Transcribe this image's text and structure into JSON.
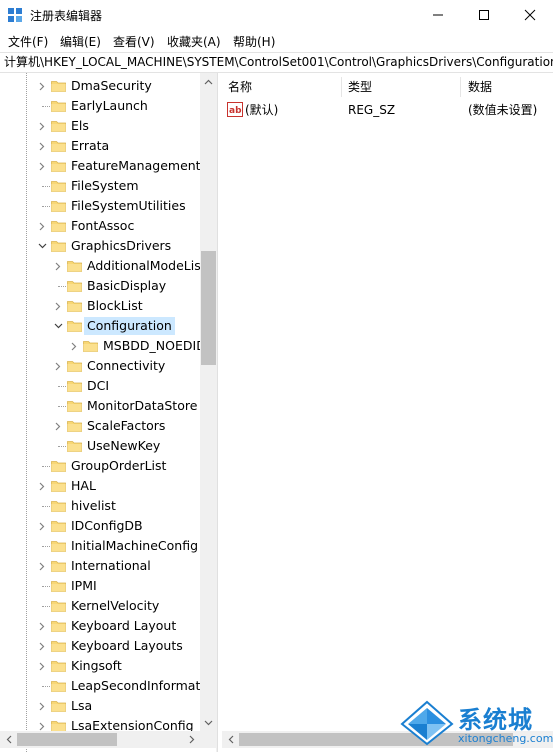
{
  "window": {
    "title": "注册表编辑器",
    "icon": "registry-editor-icon",
    "buttons": [
      "minimize-icon",
      "maximize-icon",
      "close-icon"
    ]
  },
  "menu": [
    "文件(F)",
    "编辑(E)",
    "查看(V)",
    "收藏夹(A)",
    "帮助(H)"
  ],
  "address": "计算机\\HKEY_LOCAL_MACHINE\\SYSTEM\\ControlSet001\\Control\\GraphicsDrivers\\Configuration",
  "tree": {
    "items": [
      {
        "label": "DmaSecurity",
        "level": 0,
        "expander": "collapsed"
      },
      {
        "label": "EarlyLaunch",
        "level": 0,
        "expander": "none"
      },
      {
        "label": "Els",
        "level": 0,
        "expander": "collapsed"
      },
      {
        "label": "Errata",
        "level": 0,
        "expander": "collapsed"
      },
      {
        "label": "FeatureManagement",
        "level": 0,
        "expander": "collapsed"
      },
      {
        "label": "FileSystem",
        "level": 0,
        "expander": "none"
      },
      {
        "label": "FileSystemUtilities",
        "level": 0,
        "expander": "none"
      },
      {
        "label": "FontAssoc",
        "level": 0,
        "expander": "collapsed"
      },
      {
        "label": "GraphicsDrivers",
        "level": 0,
        "expander": "expanded"
      },
      {
        "label": "AdditionalModeList",
        "level": 1,
        "expander": "collapsed"
      },
      {
        "label": "BasicDisplay",
        "level": 1,
        "expander": "none"
      },
      {
        "label": "BlockList",
        "level": 1,
        "expander": "collapsed"
      },
      {
        "label": "Configuration",
        "level": 1,
        "expander": "expanded",
        "selected": true
      },
      {
        "label": "MSBDD_NOEDID",
        "level": 2,
        "expander": "collapsed"
      },
      {
        "label": "Connectivity",
        "level": 1,
        "expander": "collapsed"
      },
      {
        "label": "DCI",
        "level": 1,
        "expander": "none"
      },
      {
        "label": "MonitorDataStore",
        "level": 1,
        "expander": "none"
      },
      {
        "label": "ScaleFactors",
        "level": 1,
        "expander": "collapsed"
      },
      {
        "label": "UseNewKey",
        "level": 1,
        "expander": "none"
      },
      {
        "label": "GroupOrderList",
        "level": 0,
        "expander": "none"
      },
      {
        "label": "HAL",
        "level": 0,
        "expander": "collapsed"
      },
      {
        "label": "hivelist",
        "level": 0,
        "expander": "none"
      },
      {
        "label": "IDConfigDB",
        "level": 0,
        "expander": "collapsed"
      },
      {
        "label": "InitialMachineConfig",
        "level": 0,
        "expander": "none"
      },
      {
        "label": "International",
        "level": 0,
        "expander": "collapsed"
      },
      {
        "label": "IPMI",
        "level": 0,
        "expander": "none"
      },
      {
        "label": "KernelVelocity",
        "level": 0,
        "expander": "none"
      },
      {
        "label": "Keyboard Layout",
        "level": 0,
        "expander": "collapsed"
      },
      {
        "label": "Keyboard Layouts",
        "level": 0,
        "expander": "collapsed"
      },
      {
        "label": "Kingsoft",
        "level": 0,
        "expander": "collapsed"
      },
      {
        "label": "LeapSecondInformation",
        "level": 0,
        "expander": "none"
      },
      {
        "label": "Lsa",
        "level": 0,
        "expander": "collapsed"
      },
      {
        "label": "LsaExtensionConfig",
        "level": 0,
        "expander": "collapsed"
      }
    ]
  },
  "list": {
    "columns": [
      "名称",
      "类型",
      "数据"
    ],
    "rows": [
      {
        "name": "(默认)",
        "type": "REG_SZ",
        "data": "(数值未设置)",
        "icon": "string-value-icon"
      }
    ]
  },
  "watermark": {
    "title": "系统城",
    "url": "xitongcheng.com"
  },
  "colors": {
    "selection": "#cce8ff",
    "folder": "#f8d775",
    "accent": "#1a7fd1"
  }
}
